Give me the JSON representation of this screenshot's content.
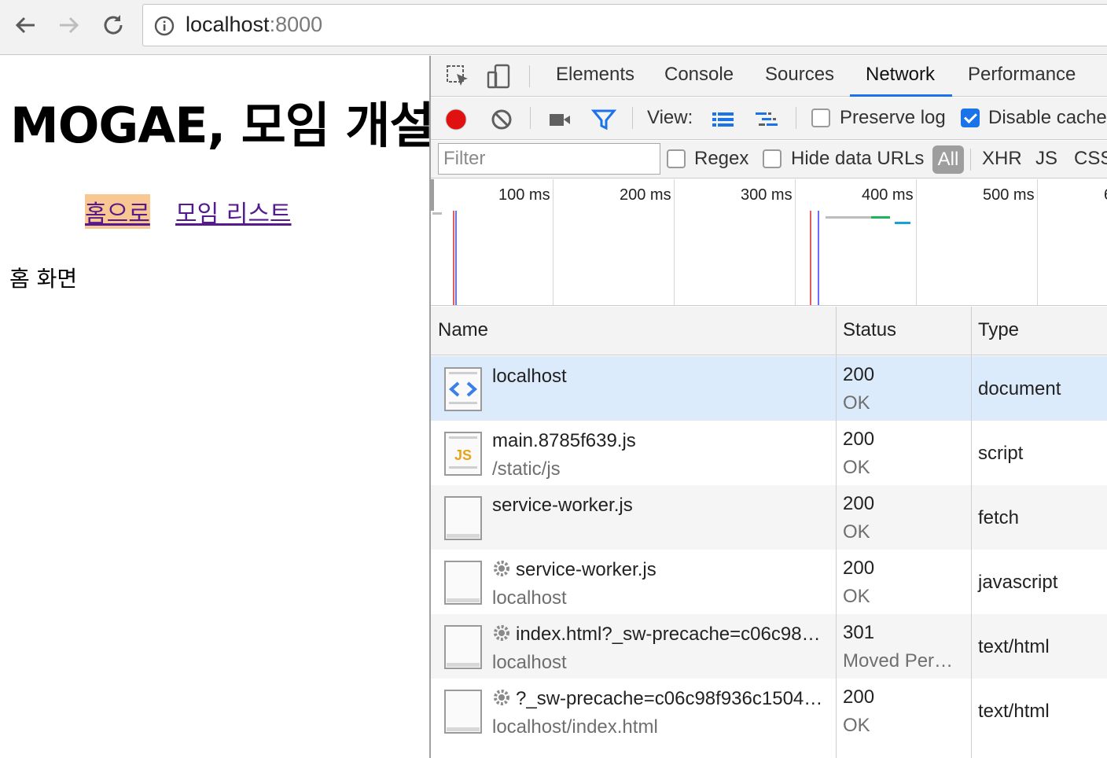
{
  "browser": {
    "url_host": "localhost",
    "url_port": ":8000",
    "icons": [
      "back-arrow-icon",
      "forward-arrow-icon",
      "reload-icon",
      "info-icon"
    ]
  },
  "page": {
    "title": "MOGAE, 모임 개설",
    "links": [
      {
        "label": "홈으로",
        "active": true
      },
      {
        "label": "모임 리스트",
        "active": false
      }
    ],
    "body_text": "홈 화면"
  },
  "devtools": {
    "tabs": [
      "Elements",
      "Console",
      "Sources",
      "Network",
      "Performance"
    ],
    "active_tab": "Network",
    "toolbar": {
      "view_label": "View:",
      "preserve_log_label": "Preserve log",
      "preserve_log_checked": false,
      "disable_cache_label": "Disable cache",
      "disable_cache_checked": true
    },
    "filterbar": {
      "filter_placeholder": "Filter",
      "regex_label": "Regex",
      "hide_data_urls_label": "Hide data URLs",
      "types": [
        "All",
        "XHR",
        "JS",
        "CSS"
      ],
      "active_type": "All"
    },
    "overview": {
      "ticks": [
        "100 ms",
        "200 ms",
        "300 ms",
        "400 ms",
        "500 ms",
        "6"
      ]
    },
    "table": {
      "columns": [
        "Name",
        "Status",
        "Type"
      ],
      "rows": [
        {
          "name": "localhost",
          "sub": "",
          "status": "200",
          "status_text": "OK",
          "type": "document",
          "icon": "html-file-icon",
          "gear": false
        },
        {
          "name": "main.8785f639.js",
          "sub": "/static/js",
          "status": "200",
          "status_text": "OK",
          "type": "script",
          "icon": "js-file-icon",
          "gear": false
        },
        {
          "name": "service-worker.js",
          "sub": "",
          "status": "200",
          "status_text": "OK",
          "type": "fetch",
          "icon": "blank-file-icon",
          "gear": false
        },
        {
          "name": "service-worker.js",
          "sub": "localhost",
          "status": "200",
          "status_text": "OK",
          "type": "javascript",
          "icon": "blank-file-icon",
          "gear": true
        },
        {
          "name": "index.html?_sw-precache=c06c98…",
          "sub": "localhost",
          "status": "301",
          "status_text": "Moved Per…",
          "type": "text/html",
          "icon": "blank-file-icon",
          "gear": true
        },
        {
          "name": "?_sw-precache=c06c98f936c1504…",
          "sub": "localhost/index.html",
          "status": "200",
          "status_text": "OK",
          "type": "text/html",
          "icon": "blank-file-icon",
          "gear": true
        }
      ]
    }
  }
}
